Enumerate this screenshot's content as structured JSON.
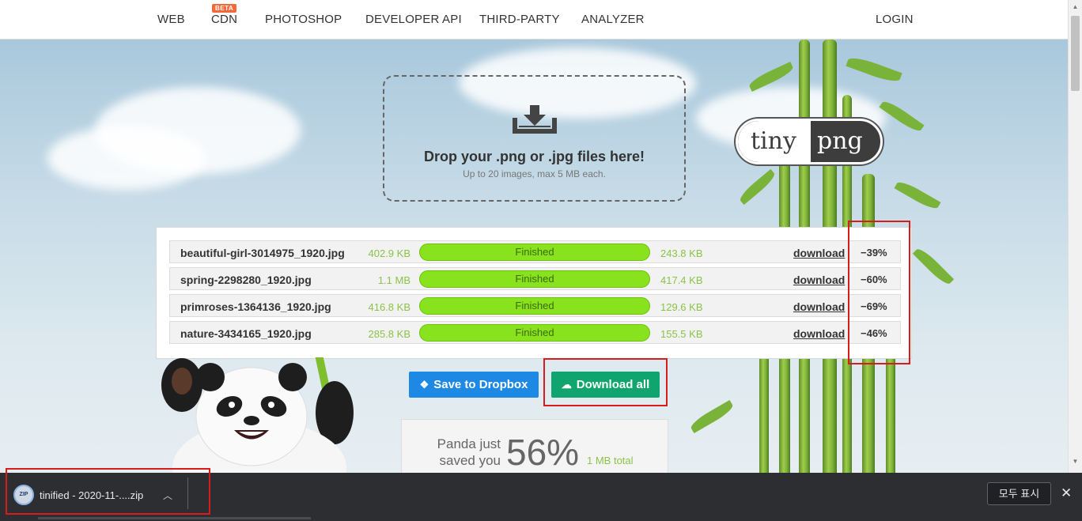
{
  "nav": {
    "items": [
      {
        "label": "WEB"
      },
      {
        "label": "CDN",
        "badge": "BETA"
      },
      {
        "label": "PHOTOSHOP"
      },
      {
        "label": "DEVELOPER API"
      },
      {
        "label": "THIRD-PARTY"
      },
      {
        "label": "ANALYZER"
      }
    ],
    "login": "LOGIN"
  },
  "dropzone": {
    "title": "Drop your .png or .jpg files here!",
    "subtitle": "Up to 20 images, max 5 MB each.",
    "icon": "download-tray-icon"
  },
  "logo": {
    "left": "tiny",
    "right": "png"
  },
  "files": [
    {
      "name": "beautiful-girl-3014975_1920.jpg",
      "original": "402.9 KB",
      "status": "Finished",
      "compressed": "243.8 KB",
      "link": "download",
      "saving": "−39%",
      "progress": 1.0
    },
    {
      "name": "spring-2298280_1920.jpg",
      "original": "1.1 MB",
      "status": "Finished",
      "compressed": "417.4 KB",
      "link": "download",
      "saving": "−60%",
      "progress": 1.0
    },
    {
      "name": "primroses-1364136_1920.jpg",
      "original": "416.8 KB",
      "status": "Finished",
      "compressed": "129.6 KB",
      "link": "download",
      "saving": "−69%",
      "progress": 1.0
    },
    {
      "name": "nature-3434165_1920.jpg",
      "original": "285.8 KB",
      "status": "Finished",
      "compressed": "155.5 KB",
      "link": "download",
      "saving": "−46%",
      "progress": 1.0
    }
  ],
  "buttons": {
    "dropbox": "Save to Dropbox",
    "download_all": "Download all"
  },
  "savings": {
    "text_line1": "Panda just",
    "text_line2": "saved you",
    "percent": "56%",
    "total": "1 MB total"
  },
  "download_bar": {
    "icon_label": "ZIP",
    "filename": "tinified - 2020-11-....zip",
    "show_all": "모두 표시",
    "close": "✕"
  },
  "colors": {
    "progress_green": "#88e21e",
    "size_green": "#8bc34a",
    "dropbox_blue": "#1e88e5",
    "download_green": "#10a56e",
    "highlight_red": "#d81b1b",
    "badge_orange": "#f36a3a"
  }
}
